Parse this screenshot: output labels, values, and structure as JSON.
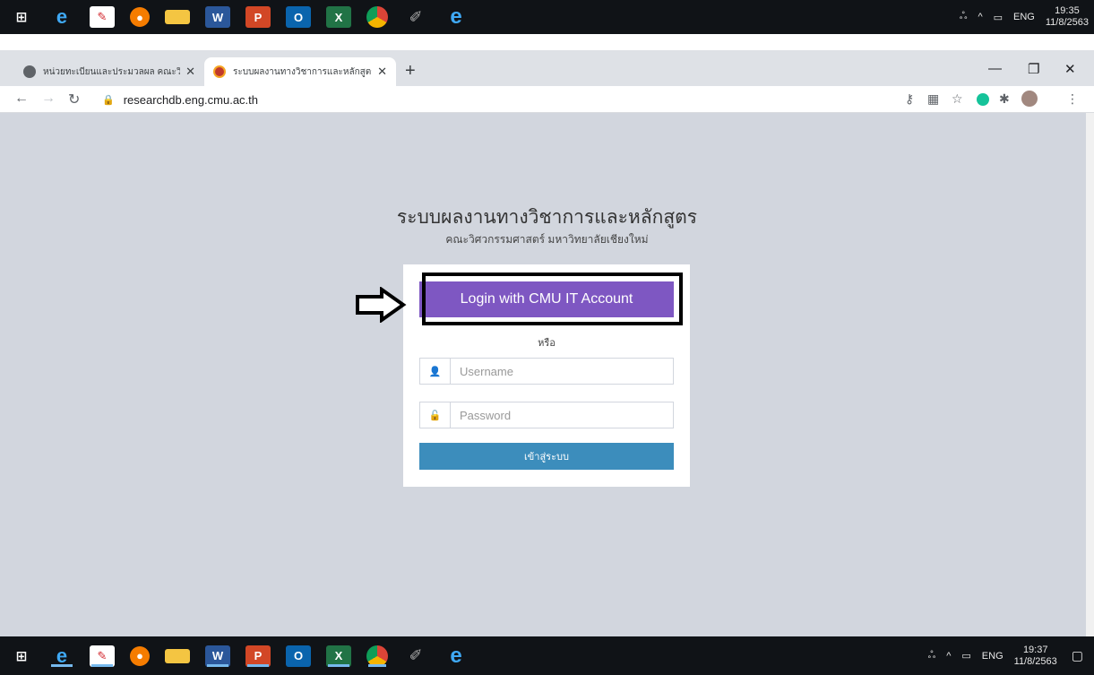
{
  "taskbar_top": {
    "icons": [
      "windows-start-icon",
      "internet-explorer-icon",
      "acrobat-icon",
      "firefox-icon",
      "file-explorer-icon",
      "word-icon",
      "powerpoint-icon",
      "outlook-icon",
      "excel-icon",
      "chrome-icon",
      "paint-icon",
      "edge-icon"
    ],
    "language": "ENG",
    "time": "19:35",
    "date": "11/8/2563"
  },
  "browser": {
    "tabs": [
      {
        "title": "หน่วยทะเบียนและประมวลผล คณะวิศวกรรมศาสตร์",
        "active": false
      },
      {
        "title": "ระบบผลงานทางวิชาการและหลักสูตร คณะวิศวกรรมศาสตร์",
        "active": true
      }
    ],
    "new_tab_symbol": "+",
    "url": "researchdb.eng.cmu.ac.th"
  },
  "page": {
    "title": "ระบบผลงานทางวิชาการและหลักสูตร",
    "subtitle": "คณะวิศวกรรมศาสตร์ มหาวิทยาลัยเชียงใหม่",
    "cmu_login_label": "Login with CMU IT Account",
    "or_label": "หรือ",
    "username_placeholder": "Username",
    "password_placeholder": "Password",
    "submit_label": "เข้าสู่ระบบ"
  },
  "colors": {
    "cmu_button": "#7e57c2",
    "submit_button": "#3c8dbc",
    "page_background": "#d2d6de"
  },
  "taskbar_bottom": {
    "language": "ENG",
    "time": "19:37",
    "date": "11/8/2563"
  }
}
